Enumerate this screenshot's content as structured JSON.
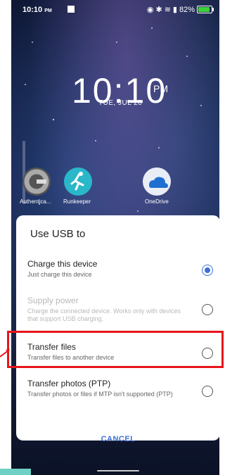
{
  "status_bar": {
    "time": "10:10",
    "time_suffix": "PM",
    "battery": "82%"
  },
  "lock_screen": {
    "clock": "10:10",
    "ampm": "PM",
    "date": "TUE, JUL 20"
  },
  "apps": [
    {
      "label": "Authentica...",
      "icon": "google-authenticator-icon"
    },
    {
      "label": "Runkeeper",
      "icon": "runkeeper-icon"
    },
    {
      "label": "OneDrive",
      "icon": "onedrive-icon"
    }
  ],
  "dialog": {
    "title": "Use USB to",
    "options": [
      {
        "title": "Charge this device",
        "subtitle": "Just charge this device",
        "selected": true,
        "enabled": true
      },
      {
        "title": "Supply power",
        "subtitle": "Charge the connected device. Works only with devices that support USB charging.",
        "selected": false,
        "enabled": false
      },
      {
        "title": "Transfer files",
        "subtitle": "Transfer files to another device",
        "selected": false,
        "enabled": true
      },
      {
        "title": "Transfer photos (PTP)",
        "subtitle": "Transfer photos or files if MTP isn't supported (PTP)",
        "selected": false,
        "enabled": true
      }
    ],
    "cancel_label": "CANCEL"
  },
  "colors": {
    "accent": "#3f6fd6",
    "highlight": "#e8141b"
  }
}
